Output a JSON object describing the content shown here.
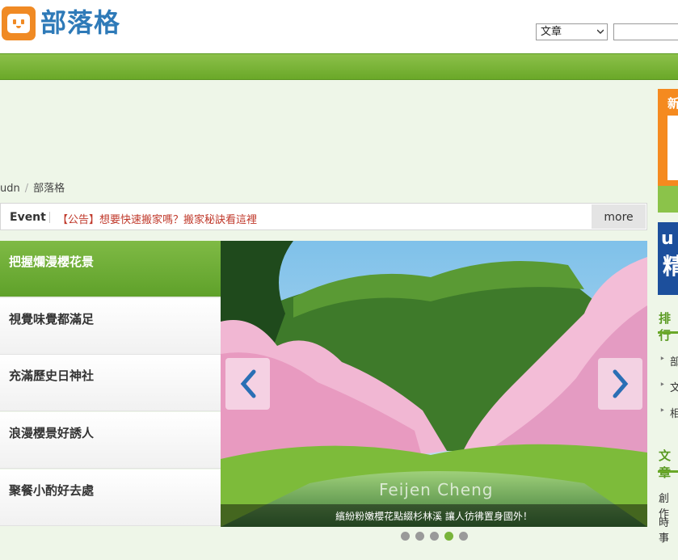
{
  "header": {
    "logo_text": "部落格",
    "search_select_value": "文章",
    "search_placeholder": ""
  },
  "breadcrumb": {
    "items": [
      "udn",
      "部落格"
    ]
  },
  "event_bar": {
    "label": "Event",
    "link_text": "【公告】想要快速搬家嗎？搬家秘訣看這裡",
    "more_label": "more"
  },
  "menu": {
    "items": [
      {
        "label": "把握爛漫櫻花景"
      },
      {
        "label": "視覺味覺都滿足"
      },
      {
        "label": "充滿歷史日神社"
      },
      {
        "label": "浪漫櫻景好誘人"
      },
      {
        "label": "聚餐小酌好去處"
      }
    ],
    "active_index": 0
  },
  "slider": {
    "watermark": "Feijen Cheng",
    "caption": "繽紛粉嫩櫻花點綴杉林溪 讓人彷彿置身國外！",
    "dot_count": 5,
    "active_dot": 3
  },
  "sidebar": {
    "banner1_text": "新",
    "banner2_text_top": "u",
    "banner2_text_bottom": "精",
    "section1_title": "排行",
    "section1_items": [
      "部",
      "文",
      "相"
    ],
    "section2_title": "文章",
    "section2_items": [
      "創作",
      "時事"
    ]
  },
  "colors": {
    "brand_green": "#6aa828",
    "brand_orange": "#f08a24",
    "logo_blue": "#2e7ab8",
    "announcement_red": "#c0392b"
  }
}
